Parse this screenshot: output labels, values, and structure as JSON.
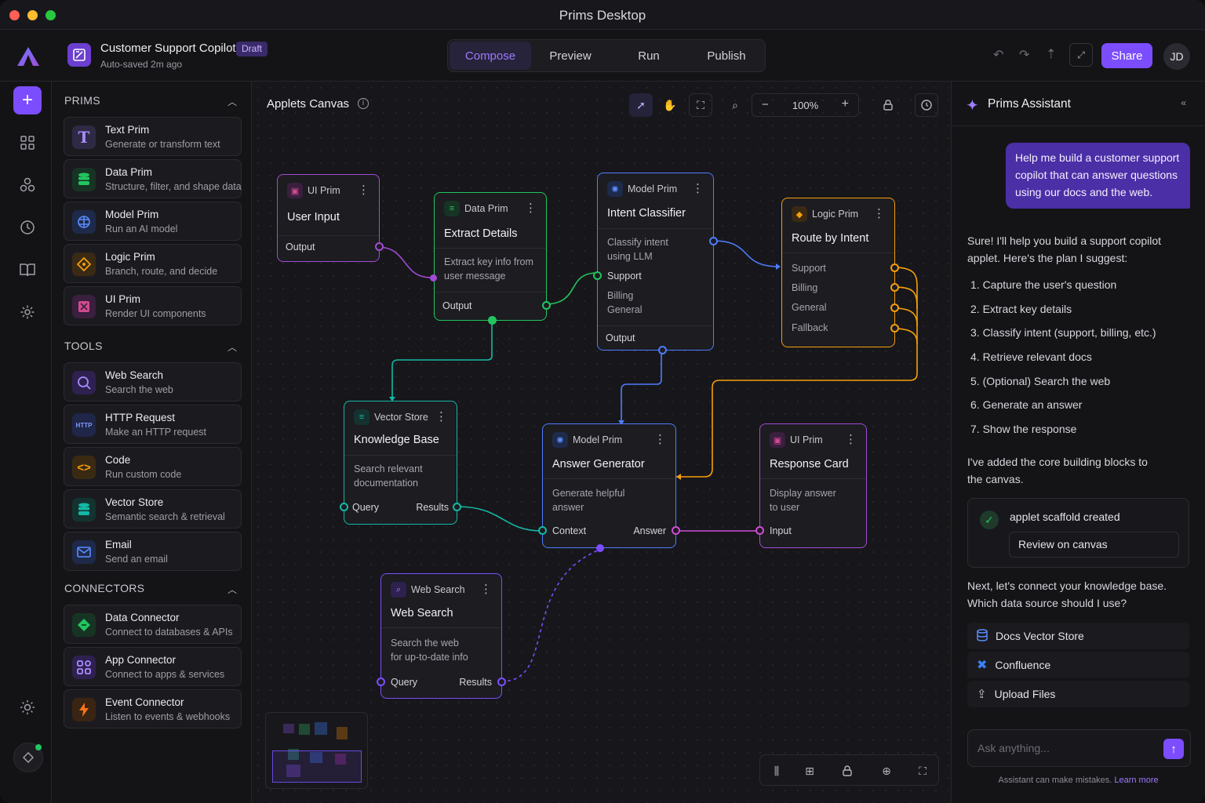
{
  "window": {
    "title": "Prims Desktop"
  },
  "project": {
    "name": "Customer Support Copilot",
    "badge": "Draft",
    "saved": "Auto-saved 2m ago"
  },
  "tabs": [
    "Compose",
    "Preview",
    "Run",
    "Publish"
  ],
  "active_tab": "Compose",
  "share_label": "Share",
  "user_initials": "JD",
  "sections": {
    "prims": {
      "title": "PRIMS",
      "items": [
        {
          "title": "Text Prim",
          "subtitle": "Generate or transform text"
        },
        {
          "title": "Data Prim",
          "subtitle": "Structure, filter, and shape data"
        },
        {
          "title": "Model Prim",
          "subtitle": "Run an AI model"
        },
        {
          "title": "Logic Prim",
          "subtitle": "Branch, route, and decide"
        },
        {
          "title": "UI Prim",
          "subtitle": "Render UI components"
        }
      ]
    },
    "tools": {
      "title": "TOOLS",
      "items": [
        {
          "title": "Web Search",
          "subtitle": "Search the web"
        },
        {
          "title": "HTTP Request",
          "subtitle": "Make an HTTP request"
        },
        {
          "title": "Code",
          "subtitle": "Run custom code"
        },
        {
          "title": "Vector Store",
          "subtitle": "Semantic search & retrieval"
        },
        {
          "title": "Email",
          "subtitle": "Send an email"
        }
      ]
    },
    "connectors": {
      "title": "CONNECTORS",
      "items": [
        {
          "title": "Data Connector",
          "subtitle": "Connect to databases & APIs"
        },
        {
          "title": "App Connector",
          "subtitle": "Connect to apps & services"
        },
        {
          "title": "Event Connector",
          "subtitle": "Listen to events & webhooks"
        }
      ]
    }
  },
  "canvas": {
    "title": "Applets Canvas",
    "zoom": "100%"
  },
  "nodes": {
    "user_input": {
      "type": "UI Prim",
      "title": "User Input",
      "output": "Output"
    },
    "extract": {
      "type": "Data Prim",
      "title": "Extract Details",
      "desc1": "Extract key info from",
      "desc2": "user message",
      "output": "Output"
    },
    "intent": {
      "type": "Model Prim",
      "title": "Intent Classifier",
      "desc1": "Classify intent",
      "desc2": "using LLM",
      "p1": "Support",
      "p2": "Billing",
      "p3": "General",
      "output": "Output"
    },
    "route": {
      "type": "Logic Prim",
      "title": "Route by Intent",
      "p1": "Support",
      "p2": "Billing",
      "p3": "General",
      "p4": "Fallback"
    },
    "kb": {
      "type": "Vector Store",
      "title": "Knowledge Base",
      "desc1": "Search relevant",
      "desc2": "documentation",
      "in": "Query",
      "out": "Results"
    },
    "answer": {
      "type": "Model Prim",
      "title": "Answer Generator",
      "desc1": "Generate helpful",
      "desc2": "answer",
      "in": "Context",
      "out": "Answer"
    },
    "card": {
      "type": "UI Prim",
      "title": "Response Card",
      "desc1": "Display answer",
      "desc2": "to user",
      "in": "Input"
    },
    "web": {
      "type": "Web Search",
      "title": "Web Search",
      "desc1": "Search the web",
      "desc2": "for up-to-date info",
      "in": "Query",
      "out": "Results"
    }
  },
  "assistant": {
    "title": "Prims Assistant",
    "user_msg": [
      "Help me build a customer support",
      "copilot that can answer questions",
      "using our docs and the web."
    ],
    "intro": [
      "Sure! I'll help you build a support copilot",
      "applet. Here's the plan I suggest:"
    ],
    "steps": [
      "1.  Capture the user's question",
      "2.  Extract key details",
      "3.  Classify intent (support, billing, etc.)",
      "4.  Retrieve relevant docs",
      "5.  (Optional) Search the web",
      "6.  Generate an answer",
      "7.  Show the response"
    ],
    "added": [
      "I've added the core building blocks to",
      "the canvas."
    ],
    "status": "applet scaffold created",
    "review": "Review on canvas",
    "next": [
      "Next, let's connect your knowledge base.",
      "Which data source should I use?"
    ],
    "options": [
      "Docs Vector Store",
      "Confluence",
      "Upload Files"
    ],
    "placeholder": "Ask anything...",
    "disclaimer": "Assistant can make mistakes.",
    "learn_more": "Learn more"
  },
  "colors": {
    "accent": "#7c4dff",
    "ui": "#a24bd6",
    "data": "#22c55e",
    "model": "#4f7cff",
    "logic": "#f59e0b",
    "vector": "#14b8a6"
  }
}
